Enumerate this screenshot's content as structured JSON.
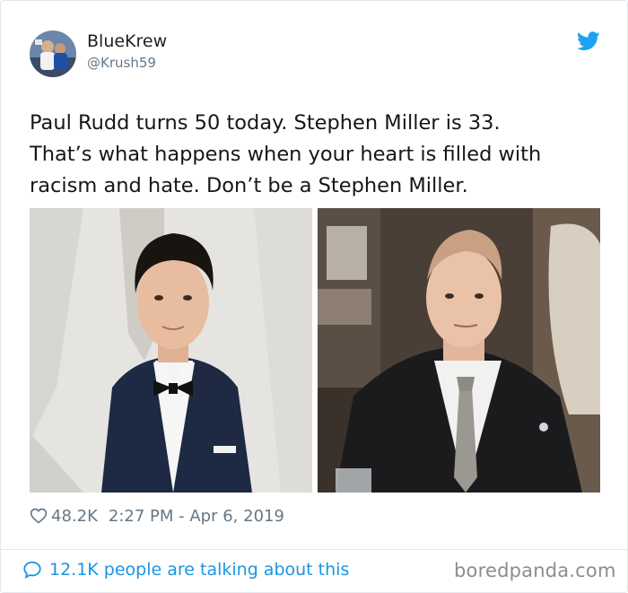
{
  "user": {
    "display_name": "BlueKrew",
    "handle": "@Krush59"
  },
  "tweet": {
    "text": "Paul Rudd turns 50 today. Stephen Miller is 33.\nThat’s what happens when your heart is filled with\nracism and hate. Don’t be a Stephen Miller."
  },
  "meta": {
    "likes": "48.2K",
    "timestamp": "2:27 PM - Apr 6, 2019"
  },
  "footer": {
    "talking": "12.1K people are talking about this",
    "watermark": "boredpanda.com"
  },
  "icons": {
    "brand": "twitter-bird-icon",
    "like": "heart-icon",
    "reply": "speech-bubble-icon"
  },
  "colors": {
    "twitter_blue": "#1da1f2",
    "link_blue": "#1b95e0",
    "muted": "#657786"
  }
}
